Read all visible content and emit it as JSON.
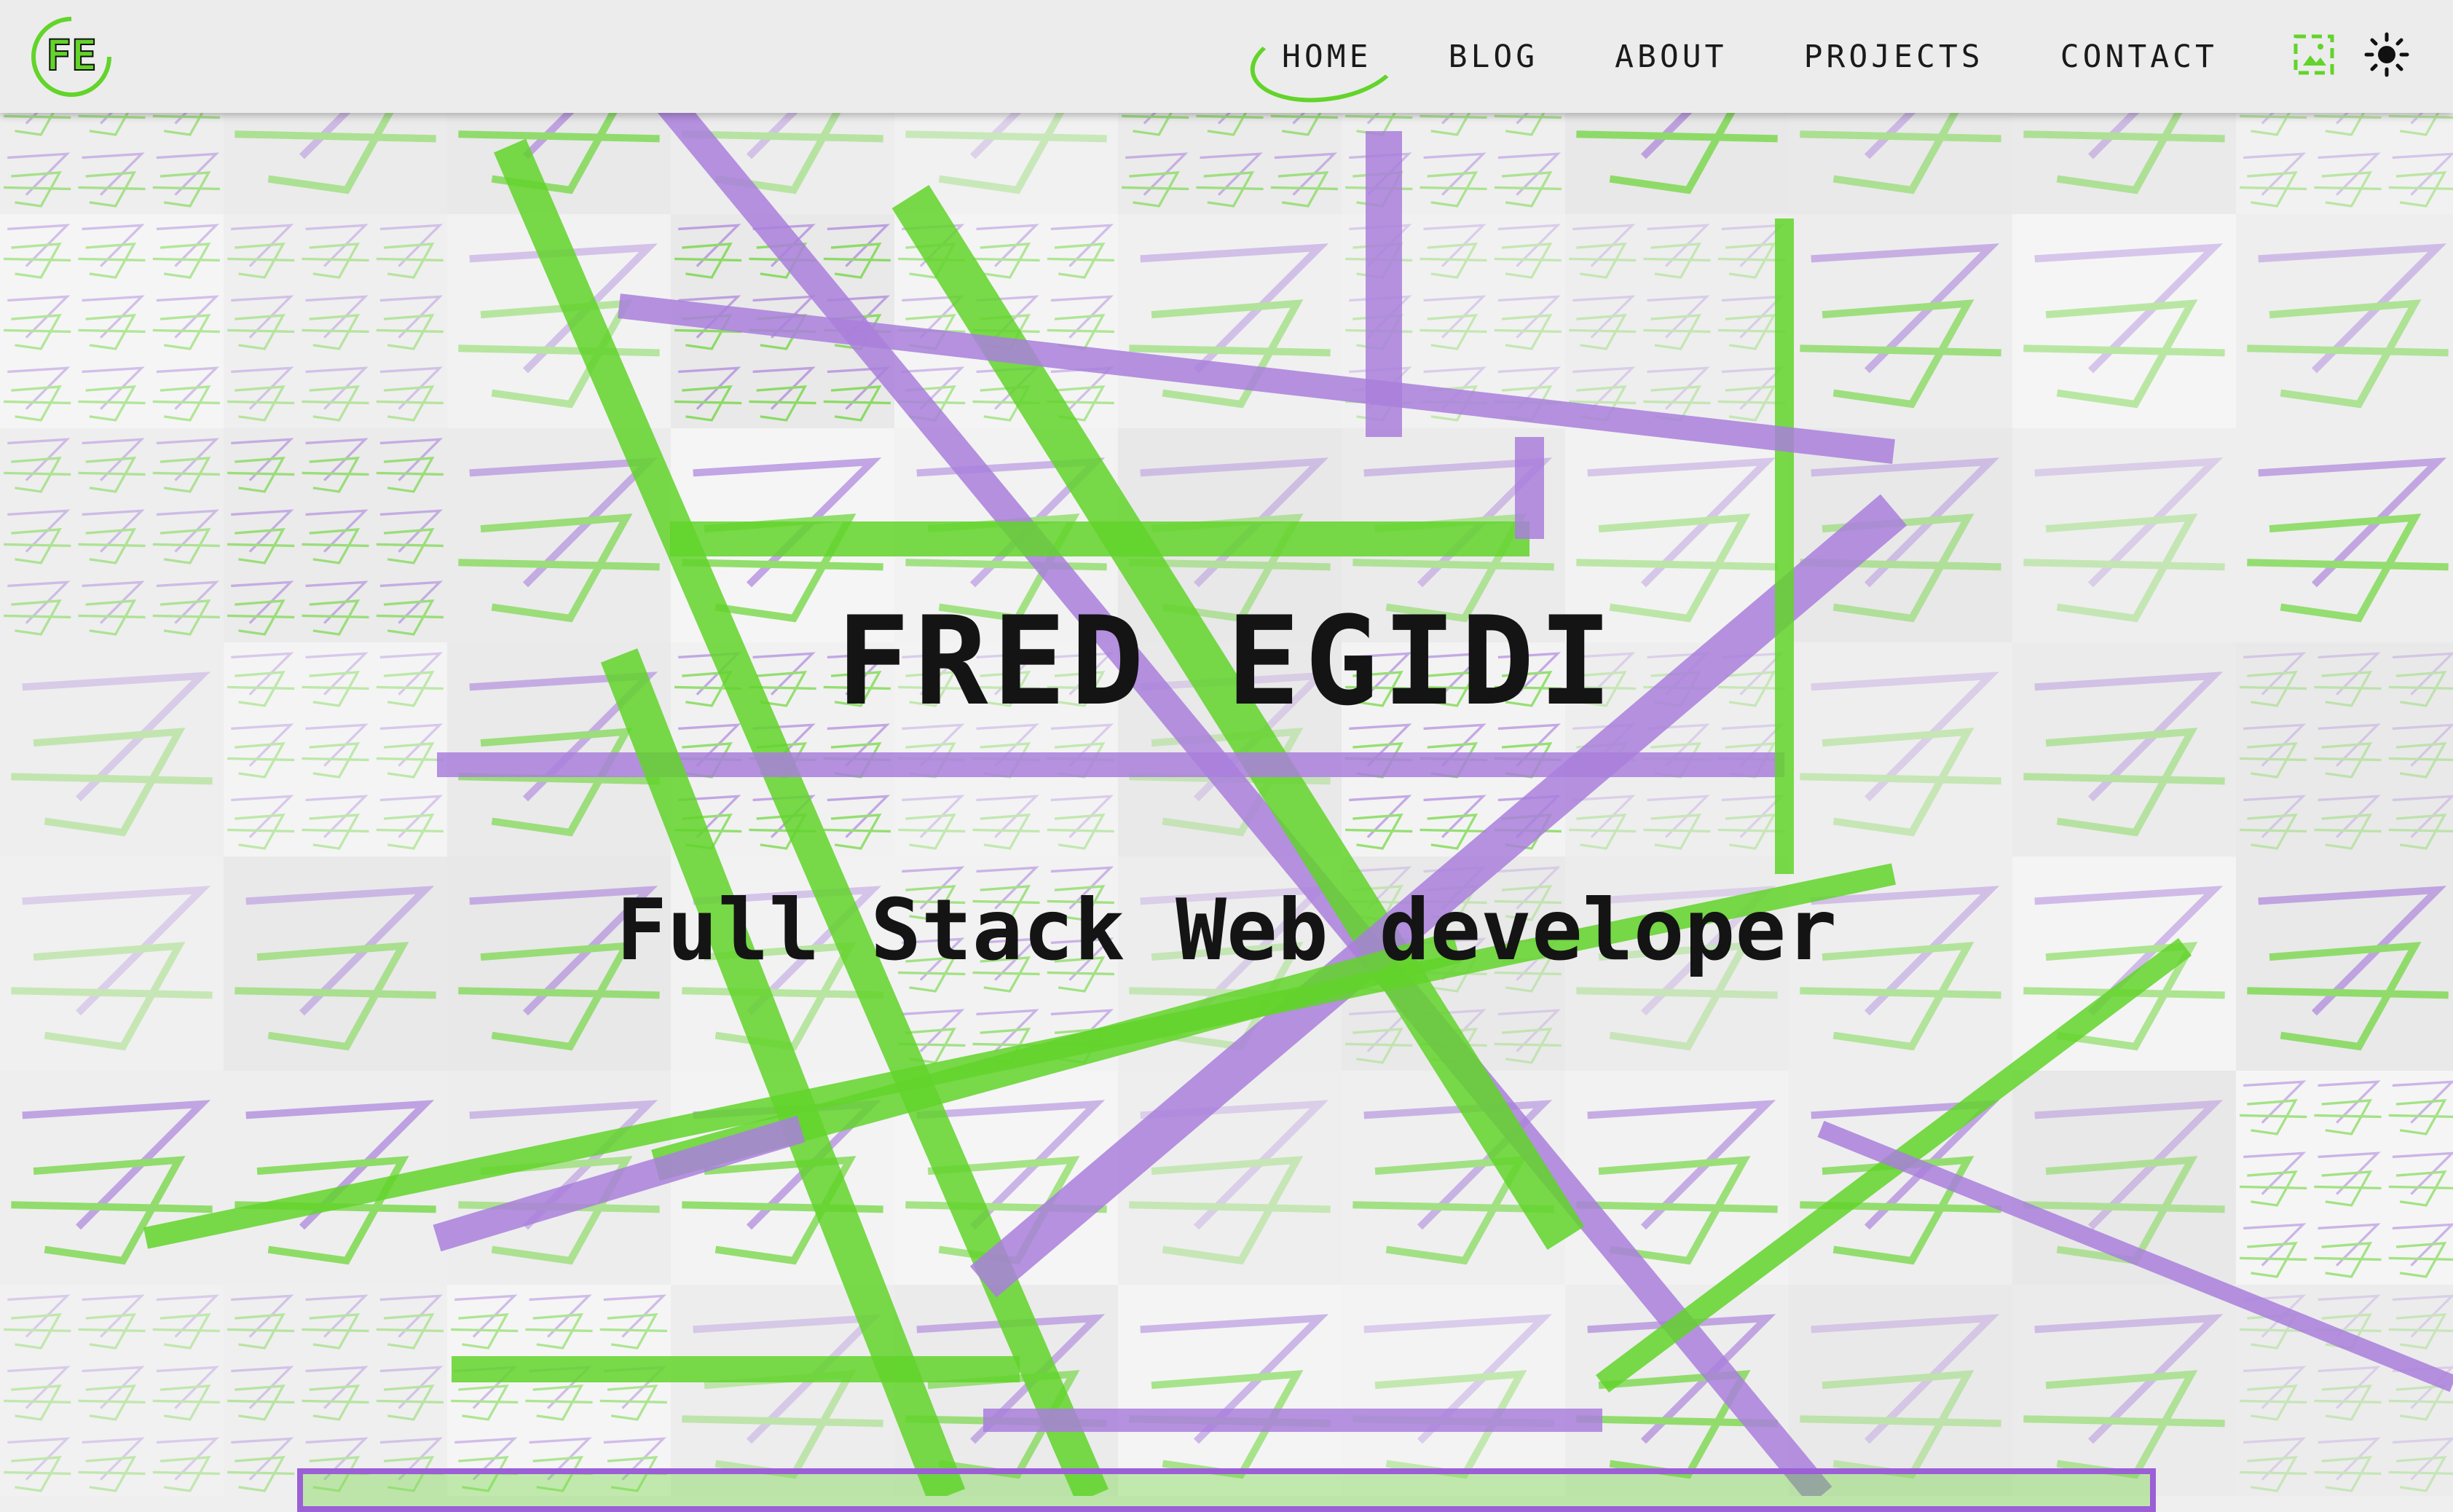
{
  "header": {
    "logo_text": "FE",
    "nav": [
      {
        "label": "HOME",
        "active": true
      },
      {
        "label": "BLOG",
        "active": false
      },
      {
        "label": "ABOUT",
        "active": false
      },
      {
        "label": "PROJECTS",
        "active": false
      },
      {
        "label": "CONTACT",
        "active": false
      }
    ],
    "icons": [
      "image-toggle-icon",
      "sun-icon"
    ]
  },
  "hero": {
    "name": "FRED EGIDI",
    "role": "Full Stack Web developer"
  },
  "colors": {
    "green": "#62d42a",
    "purple": "#a97fdc",
    "background": "#efefef",
    "text": "#141414"
  }
}
